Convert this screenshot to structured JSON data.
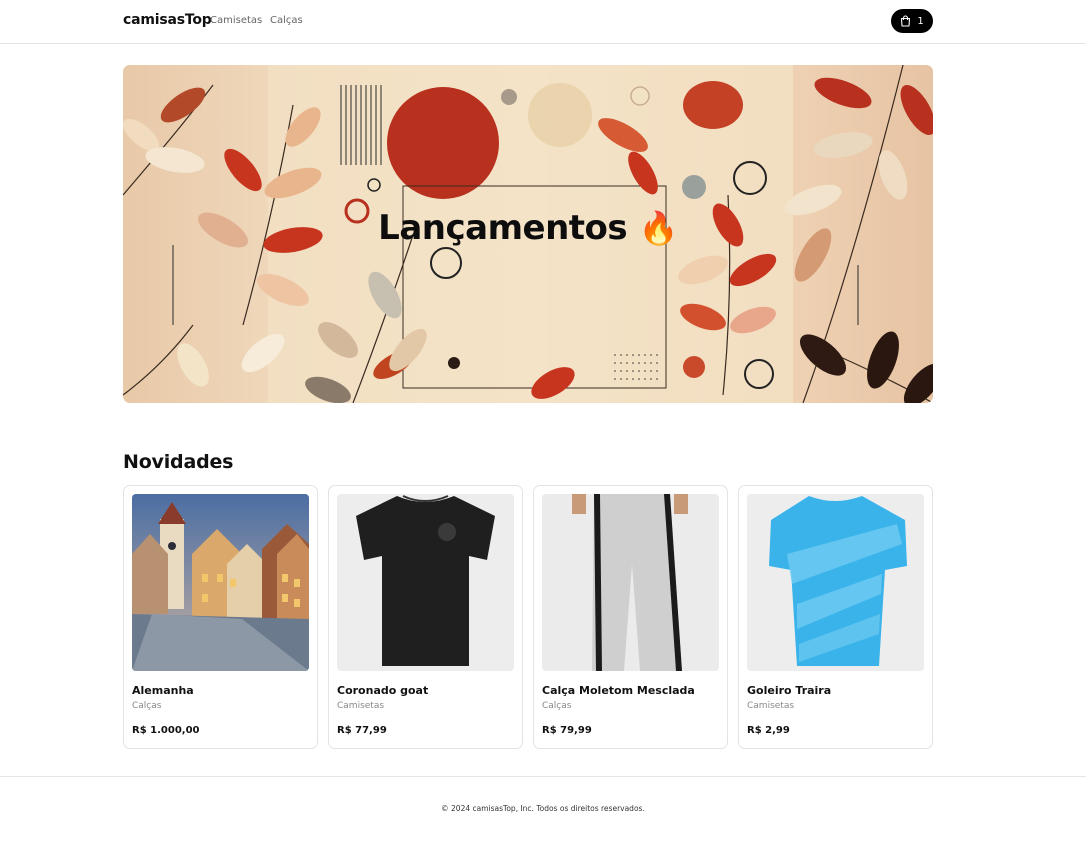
{
  "header": {
    "brand": "camisasTop",
    "nav": [
      {
        "label": "Camisetas"
      },
      {
        "label": "Calças"
      }
    ],
    "cart_count": "1"
  },
  "hero": {
    "title": "Lançamentos",
    "emoji": "🔥"
  },
  "section": {
    "title": "Novidades"
  },
  "products": [
    {
      "name": "Alemanha",
      "category": "Calças",
      "price": "R$ 1.000,00",
      "image": "town-street-photo"
    },
    {
      "name": "Coronado goat",
      "category": "Camisetas",
      "price": "R$ 77,99",
      "image": "black-tshirt"
    },
    {
      "name": "Calça Moletom Mesclada",
      "category": "Calças",
      "price": "R$ 79,99",
      "image": "grey-sweatpants"
    },
    {
      "name": "Goleiro Traira",
      "category": "Camisetas",
      "price": "R$ 2,99",
      "image": "blue-goalkeeper-jersey"
    }
  ],
  "footer": {
    "copyright": "© 2024 camisasTop, Inc. Todos os direitos reservados."
  },
  "colors": {
    "cart_bg": "#000000",
    "border": "#e5e5e5",
    "muted_text": "#888888"
  }
}
